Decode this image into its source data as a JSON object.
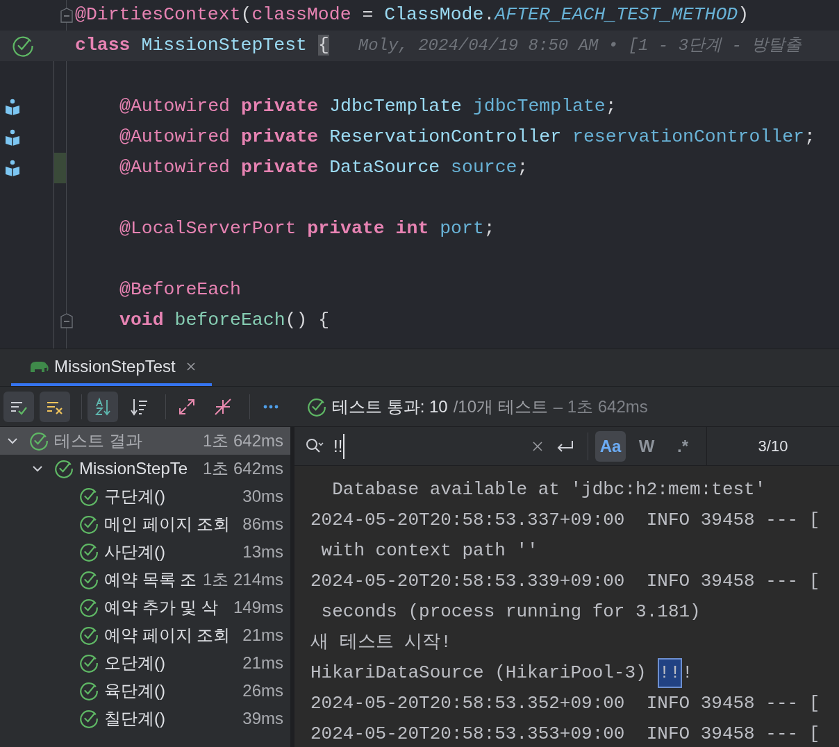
{
  "editor": {
    "lines": [
      {
        "kind": "code",
        "tokens": [
          {
            "text": "@DirtiesContext",
            "kind": "annotation"
          },
          {
            "text": "(",
            "kind": "plain"
          },
          {
            "text": "classMode",
            "kind": "annotation"
          },
          {
            "text": " = ",
            "kind": "plain"
          },
          {
            "text": "ClassMode",
            "kind": "type"
          },
          {
            "text": ".",
            "kind": "plain"
          },
          {
            "text": "AFTER_EACH_TEST_METHOD",
            "kind": "enum"
          },
          {
            "text": ")",
            "kind": "plain"
          }
        ],
        "fold": true
      },
      {
        "kind": "code",
        "tokens": [
          {
            "text": "class ",
            "kind": "keyword"
          },
          {
            "text": "MissionStepTest ",
            "kind": "type"
          },
          {
            "text": "{",
            "kind": "brace-match"
          }
        ],
        "run_marker": true,
        "current": true,
        "hint": "Moly, 2024/04/19 8:50 AM • [1 - 3단계 - 방탈출",
        "children": [
          {
            "kind": "blank"
          },
          {
            "kind": "code",
            "tokens": [
              {
                "text": "@Autowired ",
                "kind": "annotation"
              },
              {
                "text": "private ",
                "kind": "keyword"
              },
              {
                "text": "JdbcTemplate ",
                "kind": "type"
              },
              {
                "text": "jdbcTemplate",
                "kind": "field"
              },
              {
                "text": ";",
                "kind": "plain"
              }
            ],
            "bean_marker": true
          },
          {
            "kind": "code",
            "tokens": [
              {
                "text": "@Autowired ",
                "kind": "annotation"
              },
              {
                "text": "private ",
                "kind": "keyword"
              },
              {
                "text": "ReservationController ",
                "kind": "type"
              },
              {
                "text": "reservationController",
                "kind": "field"
              },
              {
                "text": ";",
                "kind": "plain"
              }
            ],
            "bean_marker": true
          },
          {
            "kind": "code",
            "tokens": [
              {
                "text": "@Autowired ",
                "kind": "annotation"
              },
              {
                "text": "private ",
                "kind": "keyword"
              },
              {
                "text": "DataSource ",
                "kind": "type"
              },
              {
                "text": "source",
                "kind": "field"
              },
              {
                "text": ";",
                "kind": "plain"
              }
            ],
            "bean_marker": true,
            "changed": true
          },
          {
            "kind": "blank"
          },
          {
            "kind": "code",
            "tokens": [
              {
                "text": "@LocalServerPort ",
                "kind": "annotation"
              },
              {
                "text": "private int ",
                "kind": "keyword"
              },
              {
                "text": "port",
                "kind": "field"
              },
              {
                "text": ";",
                "kind": "plain"
              }
            ]
          },
          {
            "kind": "blank"
          },
          {
            "kind": "code",
            "tokens": [
              {
                "text": "@BeforeEach",
                "kind": "annotation"
              }
            ]
          },
          {
            "kind": "code",
            "tokens": [
              {
                "text": "void ",
                "kind": "keyword"
              },
              {
                "text": "beforeEach",
                "kind": "method"
              },
              {
                "text": "() {",
                "kind": "plain"
              }
            ],
            "fold": true
          }
        ]
      }
    ]
  },
  "run_panel": {
    "tabs": [
      {
        "label": "MissionStepTest",
        "selected": true
      }
    ],
    "toolbar": [
      [
        {
          "kind": "show-passed",
          "selected": true
        },
        {
          "kind": "show-ignored",
          "selected": true
        }
      ],
      [
        {
          "kind": "sort-alpha",
          "selected": true
        },
        {
          "kind": "sort-duration",
          "selected": false
        }
      ],
      [
        {
          "kind": "expand-all",
          "selected": false
        },
        {
          "kind": "collapse-all",
          "selected": false
        }
      ],
      [
        {
          "kind": "more",
          "selected": false
        }
      ]
    ],
    "summary": {
      "passed": true,
      "label": "테스트 통과: 10",
      "count": "/10개 테스트",
      "duration": "– 1초 642ms"
    },
    "tree": [
      {
        "label": "테스트 결과",
        "time": "1초 642ms",
        "passed": true,
        "expanded": true,
        "selected": true,
        "children": [
          {
            "label": "MissionStepTe",
            "time": "1초 642ms",
            "passed": true,
            "expanded": true,
            "selected": false,
            "children": [
              {
                "label": "구단계()",
                "time": "30ms",
                "passed": true,
                "selected": false
              },
              {
                "label": "메인 페이지 조회",
                "time": "86ms",
                "passed": true,
                "selected": false
              },
              {
                "label": "사단계()",
                "time": "13ms",
                "passed": true,
                "selected": false
              },
              {
                "label": "예약 목록 조",
                "time": "1초 214ms",
                "passed": true,
                "selected": false
              },
              {
                "label": "예약 추가 및 삭",
                "time": "149ms",
                "passed": true,
                "selected": false
              },
              {
                "label": "예약 페이지 조회",
                "time": "21ms",
                "passed": true,
                "selected": false
              },
              {
                "label": "오단계()",
                "time": "21ms",
                "passed": true,
                "selected": false
              },
              {
                "label": "육단계()",
                "time": "26ms",
                "passed": true,
                "selected": false
              },
              {
                "label": "칠단계()",
                "time": "39ms",
                "passed": true,
                "selected": false
              }
            ]
          }
        ]
      }
    ],
    "search": {
      "value": "!!",
      "options": [
        {
          "label": "Aa",
          "selected": true
        },
        {
          "label": "W",
          "selected": false
        },
        {
          "label": ".*",
          "selected": false
        }
      ],
      "match_count": "3/10"
    },
    "console": [
      {
        "parts": [
          {
            "text": "  Database available at 'jdbc:h2:mem:test'",
            "highlight": false
          }
        ]
      },
      {
        "parts": [
          {
            "text": "2024-05-20T20:58:53.337+09:00  INFO 39458 --- [",
            "highlight": false
          }
        ]
      },
      {
        "parts": [
          {
            "text": " with context path ''",
            "highlight": false
          }
        ]
      },
      {
        "parts": [
          {
            "text": "2024-05-20T20:58:53.339+09:00  INFO 39458 --- [",
            "highlight": false
          }
        ]
      },
      {
        "parts": [
          {
            "text": " seconds (process running for 3.181)",
            "highlight": false
          }
        ]
      },
      {
        "parts": [
          {
            "text": "새 테스트 시작!",
            "highlight": false
          }
        ]
      },
      {
        "parts": [
          {
            "text": "HikariDataSource (HikariPool-3)",
            "highlight": false
          },
          {
            "text": "!!",
            "highlight": true
          },
          {
            "text": "!",
            "highlight": false
          }
        ]
      },
      {
        "parts": [
          {
            "text": "2024-05-20T20:58:53.352+09:00  INFO 39458 --- [",
            "highlight": false
          }
        ]
      },
      {
        "parts": [
          {
            "text": "2024-05-20T20:58:53.353+09:00  INFO 39458 --- [",
            "highlight": false
          }
        ]
      }
    ]
  }
}
